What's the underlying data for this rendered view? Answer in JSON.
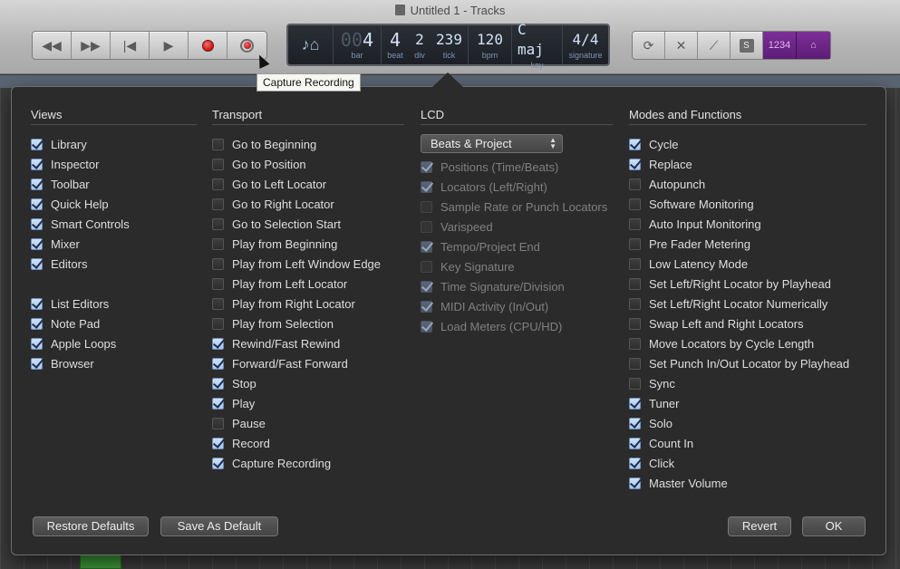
{
  "window": {
    "title": "Untitled 1 - Tracks"
  },
  "transport_buttons": [
    {
      "name": "rewind-button",
      "icon": "rewind-icon",
      "glyph": "◀◀"
    },
    {
      "name": "fast-forward-button",
      "icon": "fast-forward-icon",
      "glyph": "▶▶"
    },
    {
      "name": "go-to-beginning-button",
      "icon": "skip-back-icon",
      "glyph": "|◀"
    },
    {
      "name": "play-button",
      "icon": "play-icon",
      "glyph": "▶"
    }
  ],
  "tooltip": "Capture Recording",
  "lcd": {
    "bar": "4",
    "bar_ghost": "00",
    "bar_label": "bar",
    "beat": "4",
    "beat_label": "beat",
    "div": "2",
    "div_label": "div",
    "tick": "239",
    "tick_label": "tick",
    "bpm": "120",
    "bpm_label": "bpm",
    "key": "C maj",
    "key_label": "key",
    "signature": "4/4",
    "signature_label": "signature"
  },
  "right_buttons": {
    "count_in_glyph": "1234",
    "solo_glyph": "S"
  },
  "panel": {
    "views": {
      "header": "Views",
      "items": [
        {
          "label": "Library",
          "checked": true
        },
        {
          "label": "Inspector",
          "checked": true
        },
        {
          "label": "Toolbar",
          "checked": true
        },
        {
          "label": "Quick Help",
          "checked": true
        },
        {
          "label": "Smart Controls",
          "checked": true
        },
        {
          "label": "Mixer",
          "checked": true
        },
        {
          "label": "Editors",
          "checked": true
        },
        {
          "label": "List Editors",
          "checked": true,
          "gap": true
        },
        {
          "label": "Note Pad",
          "checked": true
        },
        {
          "label": "Apple Loops",
          "checked": true
        },
        {
          "label": "Browser",
          "checked": true
        }
      ]
    },
    "transport": {
      "header": "Transport",
      "items": [
        {
          "label": "Go to Beginning",
          "checked": false
        },
        {
          "label": "Go to Position",
          "checked": false
        },
        {
          "label": "Go to Left Locator",
          "checked": false
        },
        {
          "label": "Go to Right Locator",
          "checked": false
        },
        {
          "label": "Go to Selection Start",
          "checked": false
        },
        {
          "label": "Play from Beginning",
          "checked": false
        },
        {
          "label": "Play from Left Window Edge",
          "checked": false
        },
        {
          "label": "Play from Left Locator",
          "checked": false
        },
        {
          "label": "Play from Right Locator",
          "checked": false
        },
        {
          "label": "Play from Selection",
          "checked": false
        },
        {
          "label": "Rewind/Fast Rewind",
          "checked": true
        },
        {
          "label": "Forward/Fast Forward",
          "checked": true
        },
        {
          "label": "Stop",
          "checked": true
        },
        {
          "label": "Play",
          "checked": true
        },
        {
          "label": "Pause",
          "checked": false
        },
        {
          "label": "Record",
          "checked": true
        },
        {
          "label": "Capture Recording",
          "checked": true
        }
      ]
    },
    "lcd": {
      "header": "LCD",
      "select_value": "Beats & Project",
      "items": [
        {
          "label": "Positions (Time/Beats)",
          "checked": true
        },
        {
          "label": "Locators (Left/Right)",
          "checked": true
        },
        {
          "label": "Sample Rate or Punch Locators",
          "checked": false
        },
        {
          "label": "Varispeed",
          "checked": false
        },
        {
          "label": "Tempo/Project End",
          "checked": true
        },
        {
          "label": "Key Signature",
          "checked": false
        },
        {
          "label": "Time Signature/Division",
          "checked": true
        },
        {
          "label": "MIDI Activity (In/Out)",
          "checked": true
        },
        {
          "label": "Load Meters (CPU/HD)",
          "checked": true
        }
      ]
    },
    "modes": {
      "header": "Modes and Functions",
      "items": [
        {
          "label": "Cycle",
          "checked": true
        },
        {
          "label": "Replace",
          "checked": true
        },
        {
          "label": "Autopunch",
          "checked": false
        },
        {
          "label": "Software Monitoring",
          "checked": false
        },
        {
          "label": "Auto Input Monitoring",
          "checked": false
        },
        {
          "label": "Pre Fader Metering",
          "checked": false
        },
        {
          "label": "Low Latency Mode",
          "checked": false
        },
        {
          "label": "Set Left/Right Locator by Playhead",
          "checked": false
        },
        {
          "label": "Set Left/Right Locator Numerically",
          "checked": false
        },
        {
          "label": "Swap Left and Right Locators",
          "checked": false
        },
        {
          "label": "Move Locators by Cycle Length",
          "checked": false
        },
        {
          "label": "Set Punch In/Out Locator by Playhead",
          "checked": false
        },
        {
          "label": "Sync",
          "checked": false
        },
        {
          "label": "Tuner",
          "checked": true
        },
        {
          "label": "Solo",
          "checked": true
        },
        {
          "label": "Count In",
          "checked": true
        },
        {
          "label": "Click",
          "checked": true
        },
        {
          "label": "Master Volume",
          "checked": true
        }
      ]
    },
    "buttons": {
      "restore_defaults": "Restore Defaults",
      "save_as_default": "Save As Default",
      "revert": "Revert",
      "ok": "OK"
    }
  }
}
